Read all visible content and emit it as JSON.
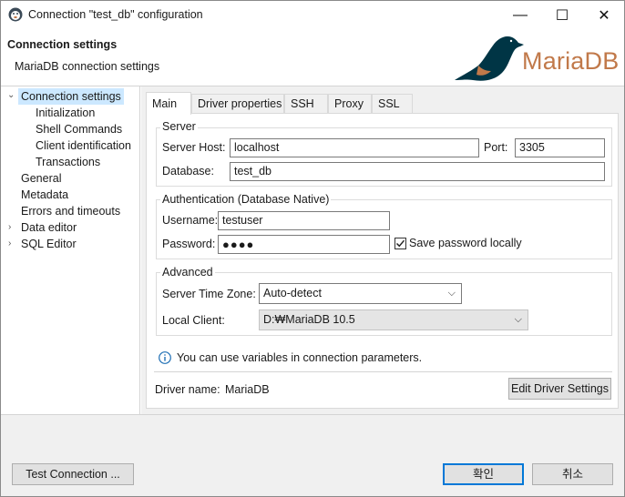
{
  "window": {
    "title": "Connection \"test_db\" configuration",
    "min": "—",
    "max": "☐",
    "close": "✕"
  },
  "header": {
    "title": "Connection settings",
    "subtitle": "MariaDB connection settings",
    "logo_text": "MariaDB"
  },
  "tree": [
    {
      "label": "Connection settings",
      "level": 0,
      "expanded": true,
      "selected": true
    },
    {
      "label": "Initialization",
      "level": 1
    },
    {
      "label": "Shell Commands",
      "level": 1
    },
    {
      "label": "Client identification",
      "level": 1
    },
    {
      "label": "Transactions",
      "level": 1
    },
    {
      "label": "General",
      "level": 0
    },
    {
      "label": "Metadata",
      "level": 0
    },
    {
      "label": "Errors and timeouts",
      "level": 0
    },
    {
      "label": "Data editor",
      "level": 0,
      "collapsed": true
    },
    {
      "label": "SQL Editor",
      "level": 0,
      "collapsed": true
    }
  ],
  "tabs": [
    "Main",
    "Driver properties",
    "SSH",
    "Proxy",
    "SSL"
  ],
  "server": {
    "group_label": "Server",
    "host_label": "Server Host:",
    "host_value": "localhost",
    "port_label": "Port:",
    "port_value": "3305",
    "db_label": "Database:",
    "db_value": "test_db"
  },
  "auth": {
    "group_label": "Authentication (Database Native)",
    "user_label": "Username:",
    "user_value": "testuser",
    "pass_label": "Password:",
    "pass_value": "●●●●",
    "save_label": "Save password locally",
    "save_checked": true
  },
  "advanced": {
    "group_label": "Advanced",
    "tz_label": "Server Time Zone:",
    "tz_value": "Auto-detect",
    "client_label": "Local Client:",
    "client_value": "D:₩MariaDB 10.5"
  },
  "info": {
    "text": "You can use variables in connection parameters."
  },
  "driver": {
    "label": "Driver name:",
    "value": "MariaDB",
    "edit_button": "Edit Driver Settings"
  },
  "footer": {
    "test_button": "Test Connection ...",
    "ok_button": "확인",
    "cancel_button": "취소"
  },
  "colors": {
    "accent": "#0078d7",
    "selection": "#cce8ff",
    "logo": "#c1794a"
  }
}
